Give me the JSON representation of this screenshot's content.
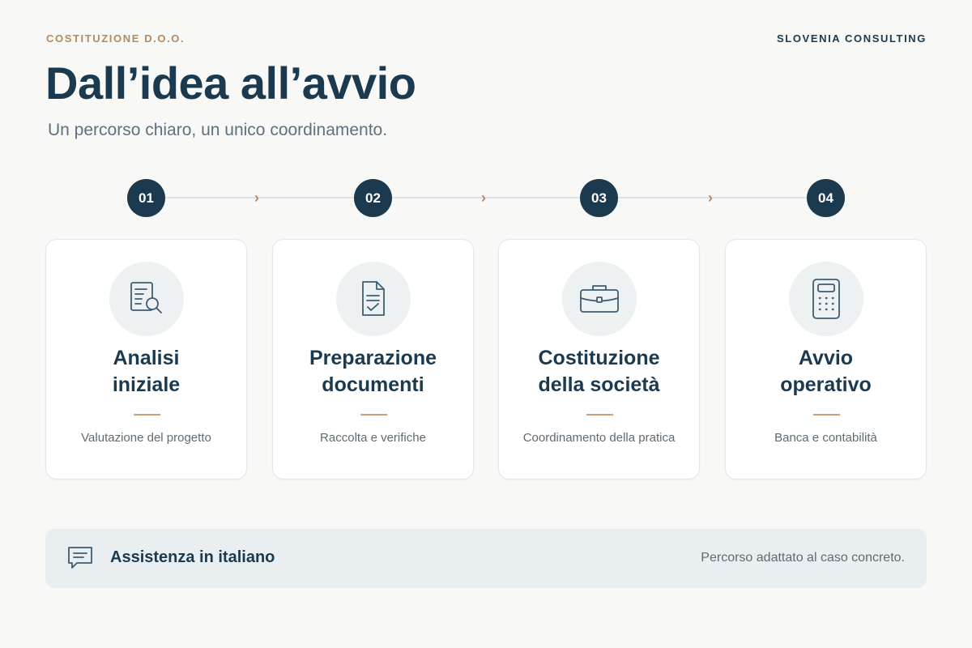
{
  "header": {
    "eyebrow": "COSTITUZIONE D.O.O.",
    "brand": "SLOVENIA CONSULTING",
    "title": "Dall’idea all’avvio",
    "subtitle": "Un percorso chiaro, un unico coordinamento."
  },
  "steps": [
    {
      "number": "01",
      "title_line1": "Analisi",
      "title_line2": "iniziale",
      "description": "Valutazione del progetto",
      "icon": "document-search-icon"
    },
    {
      "number": "02",
      "title_line1": "Preparazione",
      "title_line2": "documenti",
      "description": "Raccolta e verifiche",
      "icon": "document-check-icon"
    },
    {
      "number": "03",
      "title_line1": "Costituzione",
      "title_line2": "della società",
      "description": "Coordinamento della pratica",
      "icon": "briefcase-icon"
    },
    {
      "number": "04",
      "title_line1": "Avvio",
      "title_line2": "operativo",
      "description": "Banca e contabilità",
      "icon": "calculator-icon"
    }
  ],
  "timeline_arrow": "›",
  "banner": {
    "title": "Assistenza in italiano",
    "note": "Percorso adattato al caso concreto.",
    "icon": "chat-icon"
  },
  "colors": {
    "navy": "#1b3a4f",
    "accent": "#b48a63",
    "background": "#f8f8f6",
    "banner": "#e9eef1"
  }
}
